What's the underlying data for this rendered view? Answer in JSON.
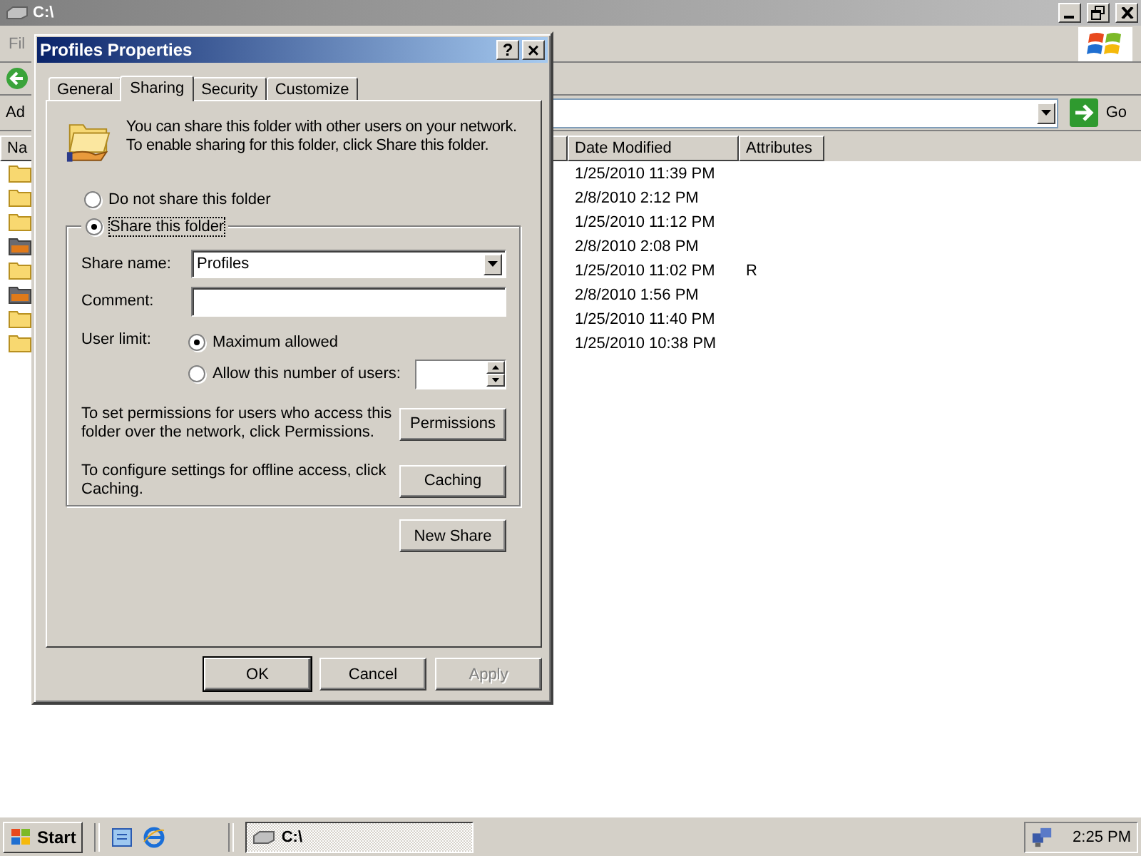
{
  "explorer": {
    "title": "C:\\",
    "menu": [
      "Fil"
    ],
    "address_label": "Ad",
    "go": "Go",
    "columns": [
      "Na",
      "Date Modified",
      "Attributes"
    ],
    "rows": [
      {
        "kind": "folder",
        "date": "1/25/2010 11:39 PM"
      },
      {
        "kind": "folder",
        "date": "2/8/2010 2:12 PM"
      },
      {
        "kind": "folder",
        "date": "1/25/2010 11:12 PM"
      },
      {
        "kind": "shared",
        "date": "2/8/2010 2:08 PM"
      },
      {
        "kind": "folder",
        "date": "1/25/2010 11:02 PM",
        "attributes": "R"
      },
      {
        "kind": "shared",
        "date": "2/8/2010 1:56 PM"
      },
      {
        "kind": "folder",
        "date": "1/25/2010 11:40 PM"
      },
      {
        "kind": "folder",
        "date": "1/25/2010 10:38 PM"
      }
    ]
  },
  "dialog": {
    "title": "Profiles Properties",
    "help": "?",
    "close": "×",
    "tabs": [
      {
        "label": "General",
        "selected": false
      },
      {
        "label": "Sharing",
        "selected": true
      },
      {
        "label": "Security",
        "selected": false
      },
      {
        "label": "Customize",
        "selected": false
      }
    ],
    "intro": "You can share this folder with other users on your network.  To enable sharing for this folder, click Share this folder.",
    "share_options": [
      {
        "label": "Do not share this folder",
        "selected": false
      },
      {
        "label": "Share this folder",
        "selected": true
      }
    ],
    "share_name_label": "Share name:",
    "share_name": "Profiles",
    "comment_label": "Comment:",
    "user_limit_label": "User limit:",
    "user_limit_options": [
      {
        "label": "Maximum allowed",
        "selected": true
      },
      {
        "label": "Allow this number of users:",
        "selected": false
      }
    ],
    "permissions_text": "To set permissions for users who access this folder over the network, click Permissions.",
    "permissions_button": "Permissions",
    "caching_text": "To configure settings for offline access, click Caching.",
    "caching_button": "Caching",
    "new_share_button": "New Share",
    "buttons": [
      {
        "label": "OK",
        "disabled": false
      },
      {
        "label": "Cancel",
        "disabled": false
      },
      {
        "label": "Apply",
        "disabled": true
      }
    ]
  },
  "taskbar": {
    "start": "Start",
    "tasks": [
      {
        "label": "C:\\",
        "selected": true
      }
    ],
    "clock": "2:25 PM"
  }
}
